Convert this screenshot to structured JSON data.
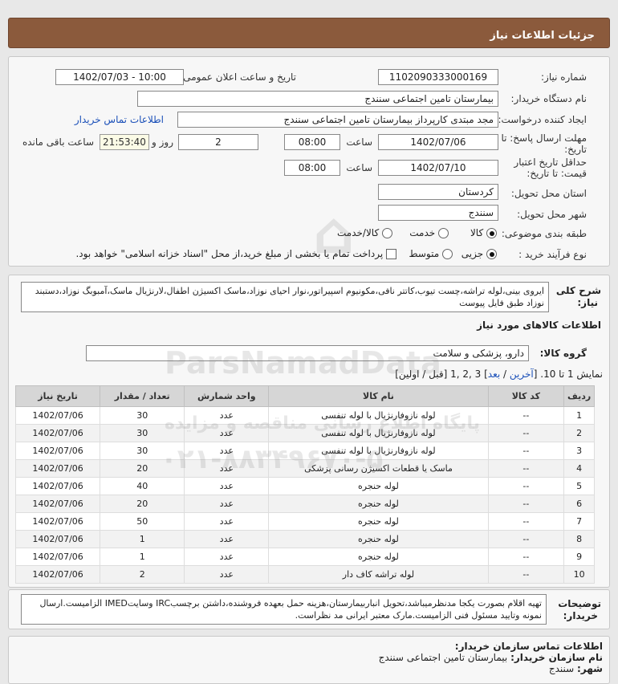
{
  "header": {
    "title": "جزئیات اطلاعات نیاز"
  },
  "form": {
    "need_number_label": "شماره نیاز:",
    "need_number": "1102090333000169",
    "announce_label": "تاریخ و ساعت اعلان عمومی:",
    "announce_value": "1402/07/03 - 10:00",
    "buyer_org_label": "نام دستگاه خریدار:",
    "buyer_org": "بیمارستان تامین اجتماعی سنندج",
    "creator_label": "ایجاد کننده درخواست:",
    "creator": "مجد مبتدی کارپرداز بیمارستان تامین اجتماعی سنندج",
    "contact_link": "اطلاعات تماس خریدار",
    "deadline_label_1": "مهلت ارسال پاسخ: تا",
    "deadline_label_2": "تاریخ:",
    "deadline_date": "1402/07/06",
    "time_label": "ساعت",
    "deadline_time": "08:00",
    "days_value": "2",
    "days_label": "روز و",
    "remaining_time": "21:53:40",
    "remaining_label": "ساعت باقی مانده",
    "validity_label_1": "حداقل تاریخ اعتبار",
    "validity_label_2": "قیمت: تا تاریخ:",
    "validity_date": "1402/07/10",
    "validity_time": "08:00",
    "province_label": "استان محل تحویل:",
    "province": "کردستان",
    "city_label": "شهر محل تحویل:",
    "city": "سنندج",
    "category_label": "طبقه بندی موضوعی:",
    "category_options": [
      "کالا",
      "خدمت",
      "کالا/خدمت"
    ],
    "process_label": "نوع فرآیند خرید :",
    "process_options": [
      "جزیی",
      "متوسط"
    ],
    "payment_note": "پرداخت تمام یا بخشی از مبلغ خرید،از محل \"اسناد خزانه اسلامی\" خواهد بود."
  },
  "summary": {
    "label_1": "شرح کلی",
    "label_2": "نیاز:",
    "text": "ایروی بینی،لوله تراشه،چست تیوب،کاتتر نافی،مکونیوم اسپیراتور،نوار احیای نوزاد،ماسک اکسیژن اطفال،لارنژیال ماسک،آمبوبگ نوزاد،دستبند نوزاد طبق فایل پیوست"
  },
  "goods": {
    "title": "اطلاعات کالاهای مورد نیاز",
    "group_label": "گروه کالا:",
    "group_value": "دارو، پزشکی و سلامت",
    "pager_text": "نمایش 1 تا 10. [",
    "pager_last": "آخرین",
    "pager_sep": " / ",
    "pager_next": "بعد",
    "pager_pages": "] 3 ,2 ,1 [قبل / اولین]",
    "columns": [
      "ردیف",
      "کد کالا",
      "نام کالا",
      "واحد شمارش",
      "تعداد / مقدار",
      "تاریخ نیاز"
    ],
    "rows": [
      [
        "1",
        "--",
        "لوله نازوفارنژیال با لوله تنفسی",
        "عدد",
        "30",
        "1402/07/06"
      ],
      [
        "2",
        "--",
        "لوله نازوفارنژیال با لوله تنفسی",
        "عدد",
        "30",
        "1402/07/06"
      ],
      [
        "3",
        "--",
        "لوله نازوفارنژیال با لوله تنفسی",
        "عدد",
        "30",
        "1402/07/06"
      ],
      [
        "4",
        "--",
        "ماسک یا قطعات اکسیژن رسانی پزشکی",
        "عدد",
        "20",
        "1402/07/06"
      ],
      [
        "5",
        "--",
        "لوله حنجره",
        "عدد",
        "40",
        "1402/07/06"
      ],
      [
        "6",
        "--",
        "لوله حنجره",
        "عدد",
        "20",
        "1402/07/06"
      ],
      [
        "7",
        "--",
        "لوله حنجره",
        "عدد",
        "50",
        "1402/07/06"
      ],
      [
        "8",
        "--",
        "لوله حنجره",
        "عدد",
        "1",
        "1402/07/06"
      ],
      [
        "9",
        "--",
        "لوله حنجره",
        "عدد",
        "1",
        "1402/07/06"
      ],
      [
        "10",
        "--",
        "لوله تراشه کاف دار",
        "عدد",
        "2",
        "1402/07/06"
      ]
    ]
  },
  "notes": {
    "label_1": "توضیحات",
    "label_2": "خریدار:",
    "text": "تهیه اقلام بصورت یکجا مدنظرمیباشد،تحویل انباربیمارستان،هزینه حمل بعهده فروشنده،داشتن برچسبIRC وسایتIMED الزامیست.ارسال نمونه وتایید مسئول فنی الزامیست.مارک معتبر ایرانی مد نظراست."
  },
  "buyer_contact": {
    "title": "اطلاعات تماس سازمان خریدار:",
    "org_label": "نام سازمان خریدار:",
    "org_value": "بیمارستان تامین اجتماعی سنندج",
    "city_label": "شهر:",
    "city_value": "سنندج"
  },
  "watermark": {
    "brand": "ParsNamadData",
    "line1": "پایگاه اطلاع رسانی مناقصه و مزایده",
    "phone": "۰۲۱-۸۸۳۴۹۶۷۰-۵"
  }
}
